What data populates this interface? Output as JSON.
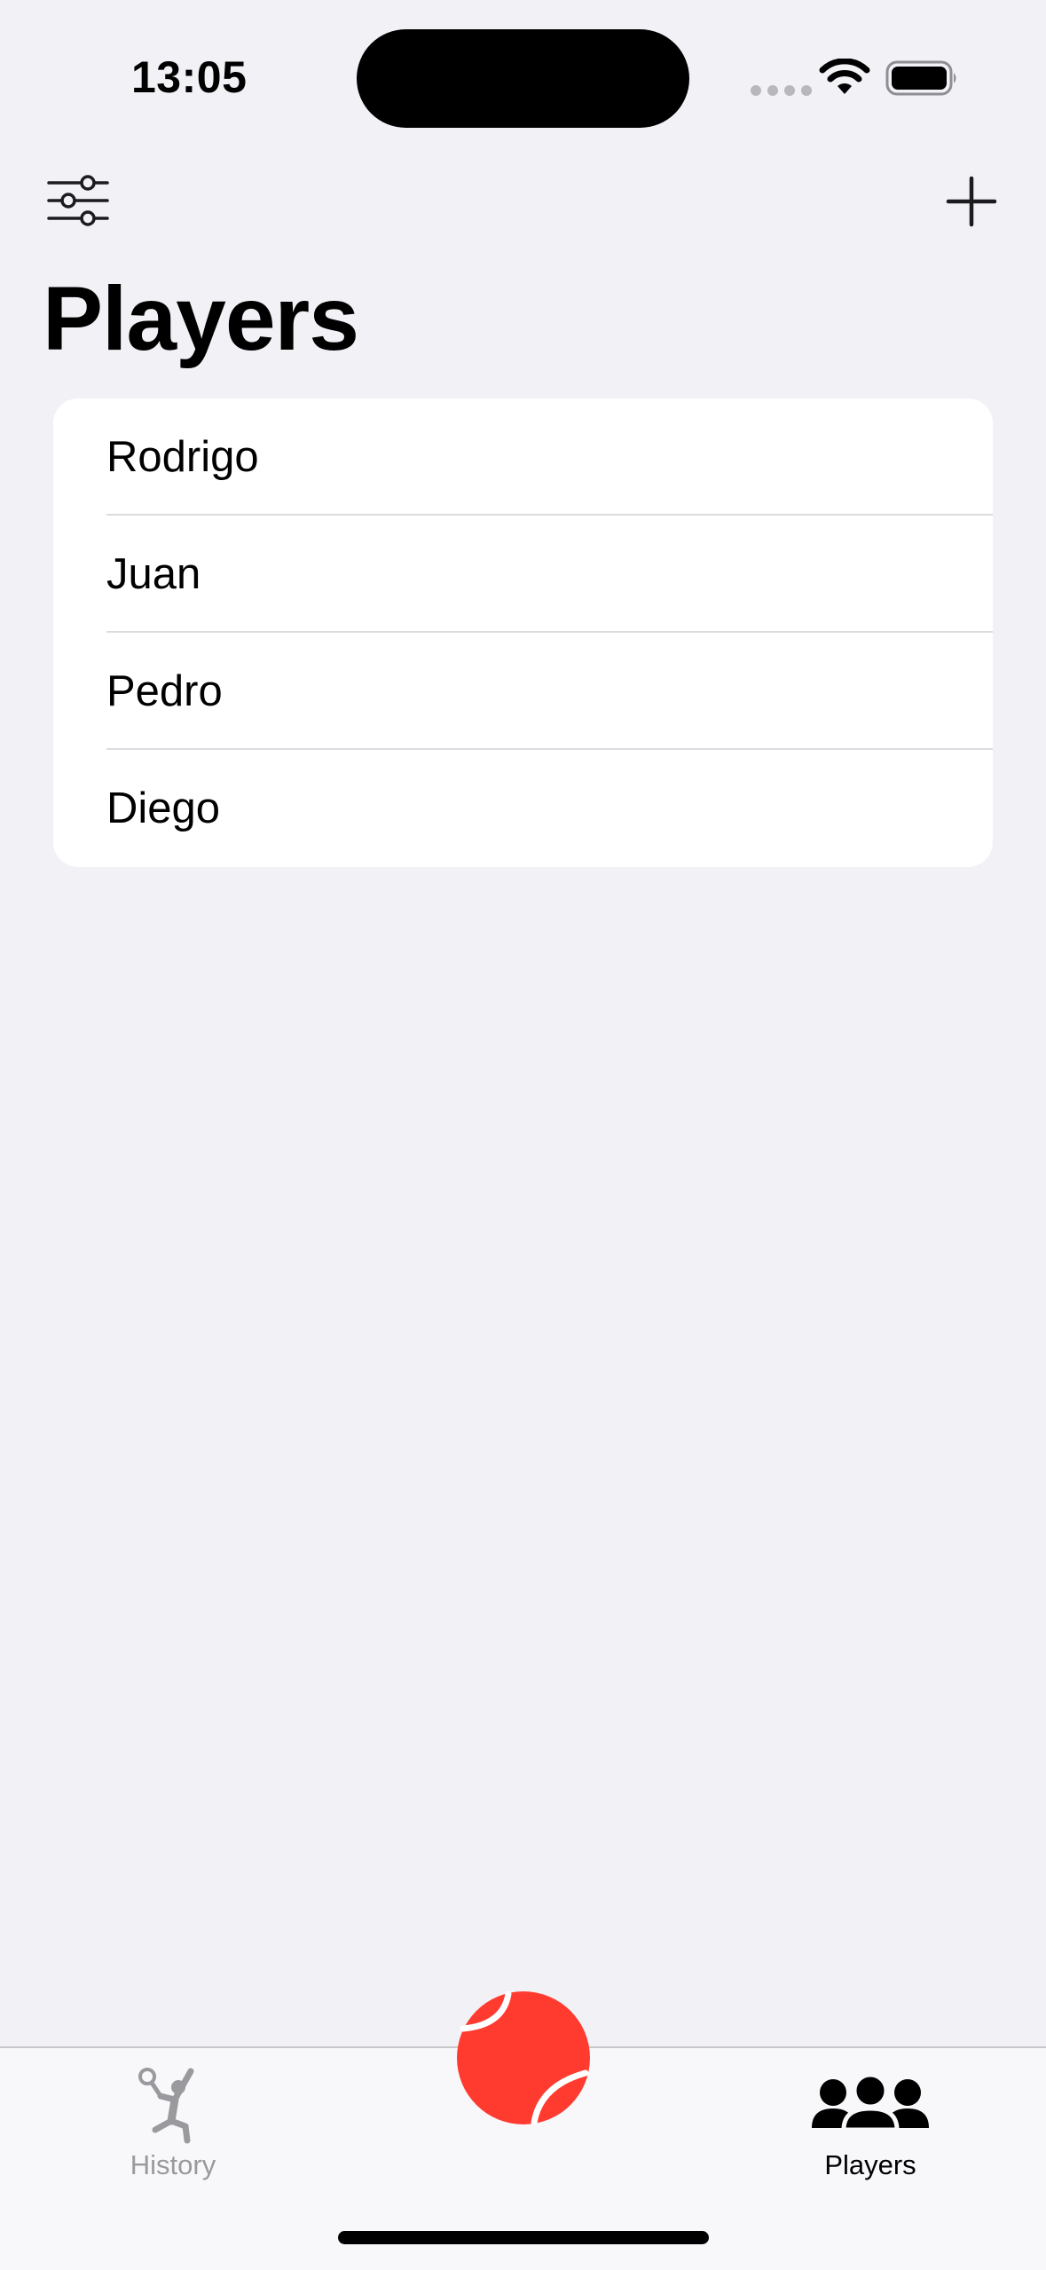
{
  "status_bar": {
    "time": "13:05"
  },
  "nav": {
    "title": "Players",
    "left_icon": "slider-horizontal-icon",
    "right_icon": "plus-icon"
  },
  "players": [
    {
      "name": "Rodrigo"
    },
    {
      "name": "Juan"
    },
    {
      "name": "Pedro"
    },
    {
      "name": "Diego"
    }
  ],
  "tab_bar": {
    "history_label": "History",
    "players_label": "Players",
    "center_icon": "tennis-ball-icon",
    "accent_color": "#FF3B30",
    "inactive_color": "#9A9A9E",
    "active_color": "#000000"
  }
}
